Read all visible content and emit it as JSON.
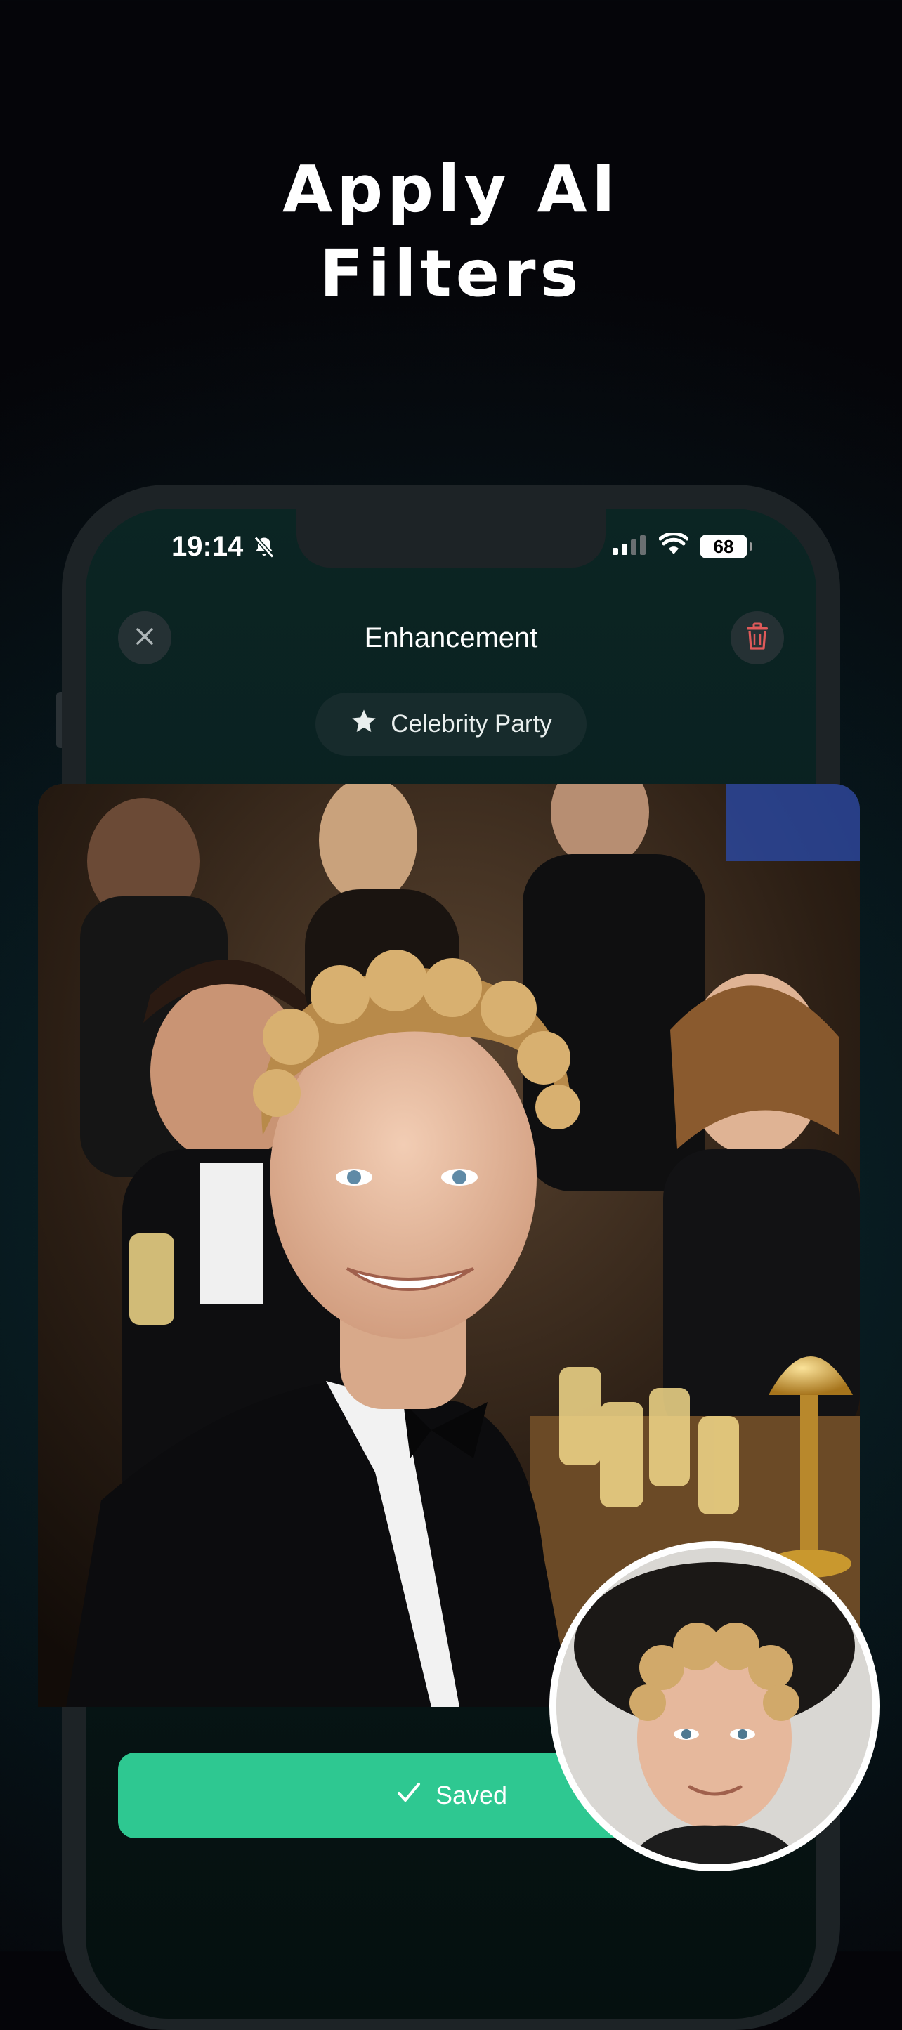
{
  "headline": {
    "line1": "Apply AI",
    "line2": "Filters"
  },
  "status_bar": {
    "time": "19:14",
    "battery": "68"
  },
  "header": {
    "title": "Enhancement",
    "close_icon": "close-icon",
    "delete_icon": "trash-icon"
  },
  "filter_chip": {
    "label": "Celebrity Party",
    "icon": "star-icon"
  },
  "action": {
    "label": "Saved",
    "icon": "checkmark-icon"
  },
  "colors": {
    "background": "#050509",
    "accent": "#2ec891",
    "delete": "#e05a5a",
    "chip_bg": "#172b2c"
  }
}
